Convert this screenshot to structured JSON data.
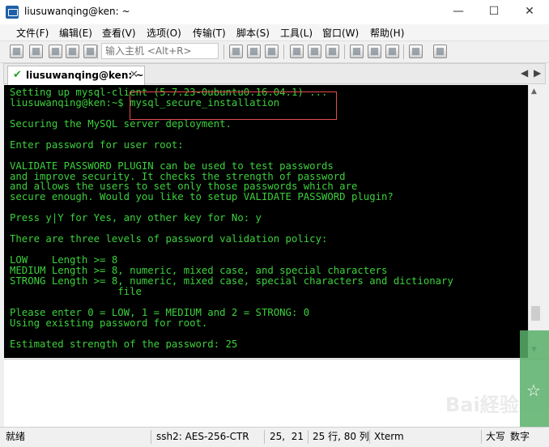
{
  "window": {
    "title": "liusuwanqing@ken: ~",
    "min_glyph": "—",
    "max_glyph": "☐",
    "close_glyph": "✕"
  },
  "menu": {
    "items": [
      "文件(F)",
      "编辑(E)",
      "查看(V)",
      "选项(O)",
      "传输(T)",
      "脚本(S)",
      "工具(L)",
      "窗口(W)",
      "帮助(H)"
    ]
  },
  "toolbar": {
    "host_placeholder": "输入主机 <Alt+R>",
    "icons_left": [
      "connect-icon",
      "quick-connect-icon",
      "new-session-icon",
      "reconnect-icon",
      "disconnect-icon",
      "options-icon"
    ],
    "icons_right": [
      "copy-icon",
      "paste-icon",
      "find-icon",
      "print-icon",
      "sftp-icon",
      "print-setup-icon",
      "settings-icon",
      "tools-icon",
      "key-icon",
      "help-icon",
      "map-icon"
    ]
  },
  "tab": {
    "label": "liusuwanqing@ken: ~",
    "active": true,
    "close_glyph": "✕",
    "prev_glyph": "◀",
    "next_glyph": "▶"
  },
  "terminal": {
    "lines": [
      "Setting up mysql-client (5.7.23-0ubuntu0.16.04.1) ...",
      "liusuwanqing@ken:~$ mysql_secure_installation",
      "",
      "Securing the MySQL server deployment.",
      "",
      "Enter password for user root:",
      "",
      "VALIDATE PASSWORD PLUGIN can be used to test passwords",
      "and improve security. It checks the strength of password",
      "and allows the users to set only those passwords which are",
      "secure enough. Would you like to setup VALIDATE PASSWORD plugin?",
      "",
      "Press y|Y for Yes, any other key for No: y",
      "",
      "There are three levels of password validation policy:",
      "",
      "LOW    Length >= 8",
      "MEDIUM Length >= 8, numeric, mixed case, and special characters",
      "STRONG Length >= 8, numeric, mixed case, special characters and dictionary",
      "                  file",
      "",
      "Please enter 0 = LOW, 1 = MEDIUM and 2 = STRONG: 0",
      "Using existing password for root.",
      "",
      "Estimated strength of the password: 25"
    ],
    "text_color": "#3cd13c",
    "prompt_color": "#d6d6d6",
    "highlight_color": "#e34b4b"
  },
  "status": {
    "ready": "就绪",
    "cipher": "ssh2: AES-256-CTR",
    "cursor": "25,  21",
    "size": "25 行, 80 列",
    "term": "Xterm",
    "caps": "大写",
    "num": "数字"
  }
}
